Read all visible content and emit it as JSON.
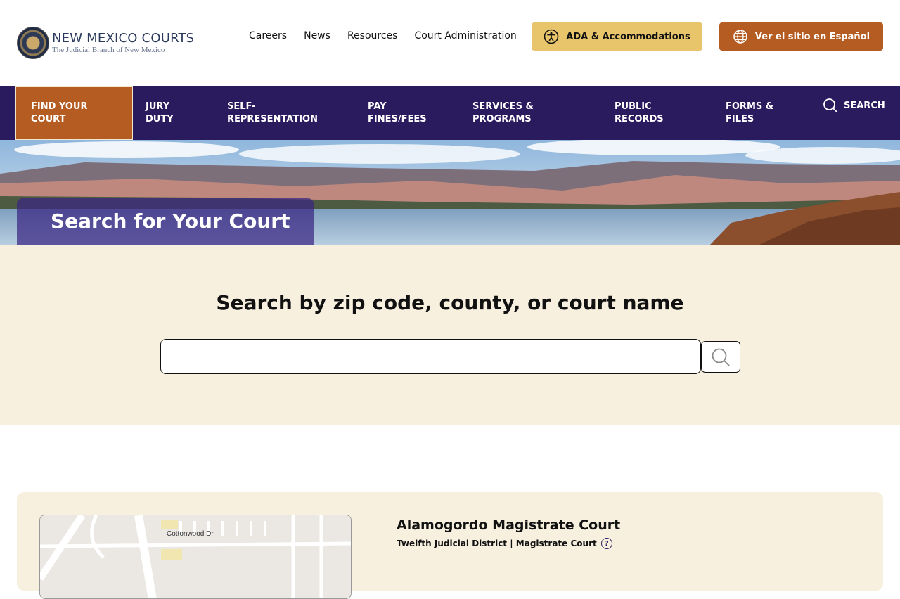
{
  "brand": {
    "title": "NEW MEXICO COURTS",
    "subtitle": "The Judicial Branch of New Mexico"
  },
  "utility_nav": [
    "Careers",
    "News",
    "Resources",
    "Court Administration"
  ],
  "ada_button": "ADA & Accommodations",
  "spanish_button": "Ver el sitio en Español",
  "main_nav": {
    "find_court": "FIND YOUR COURT",
    "jury_duty": "JURY DUTY",
    "self_representation": "SELF-REPRESENTATION",
    "pay_fines": "PAY FINES/FEES",
    "services": "SERVICES & PROGRAMS",
    "public_records": "PUBLIC RECORDS",
    "forms_files": "FORMS & FILES",
    "search": "SEARCH"
  },
  "hero": {
    "title": "Search for Your Court"
  },
  "search": {
    "heading": "Search by zip code, county, or court name",
    "value": "",
    "placeholder": ""
  },
  "result": {
    "court_name": "Alamogordo Magistrate Court",
    "district": "Twelfth Judicial District | Magistrate Court",
    "map_street": "Cottonwood Dr"
  },
  "colors": {
    "nav_bg": "#2a1a5e",
    "accent_orange": "#b55c22",
    "ada_yellow": "#e8c46a",
    "cream": "#f8f0df"
  }
}
